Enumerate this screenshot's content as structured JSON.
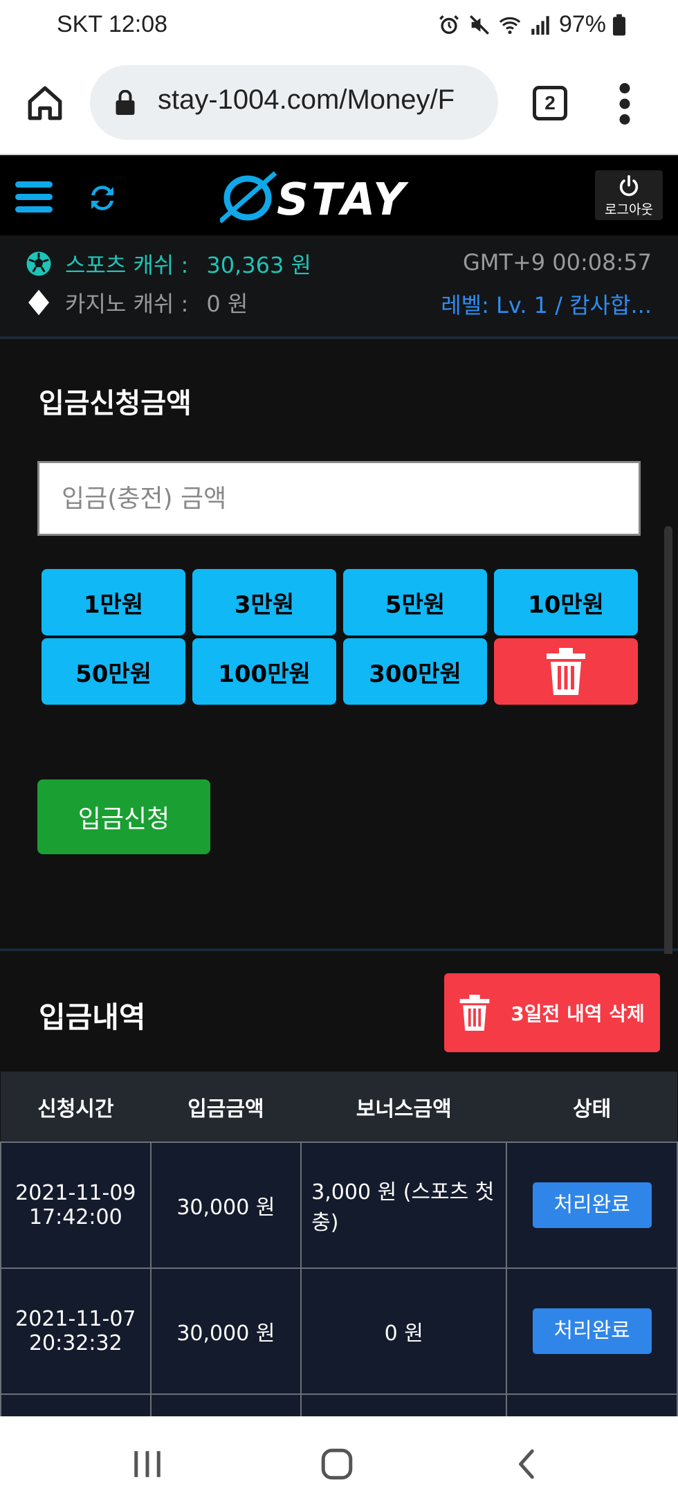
{
  "status_bar": {
    "carrier_time": "SKT  12:08",
    "battery": "97%"
  },
  "browser": {
    "url": "stay-1004.com/Money/F",
    "tab_count": "2"
  },
  "header": {
    "logo_text": "STAY",
    "logout_label": "로그아웃"
  },
  "cash": {
    "sports_label": "스포츠 캐쉬 :",
    "sports_value": "30,363 원",
    "casino_label": "카지노 캐쉬 :",
    "casino_value": "0 원",
    "gmt": "GMT+9 00:08:57",
    "level": "레벨: Lv. 1 / 캄사합..."
  },
  "deposit": {
    "title": "입금신청금액",
    "input_placeholder": "입금(충전) 금액",
    "amount_buttons": [
      "1만원",
      "3만원",
      "5만원",
      "10만원",
      "50만원",
      "100만원",
      "300만원"
    ],
    "submit_label": "입금신청"
  },
  "history": {
    "title": "입금내역",
    "delete_old_label": "3일전 내역 삭제",
    "columns": [
      "신청시간",
      "입금금액",
      "보너스금액",
      "상태"
    ],
    "rows": [
      {
        "date": "2021-11-09",
        "time": "17:42:00",
        "amount": "30,000 원",
        "bonus": "3,000 원 (스포츠 첫충)",
        "status": "처리완료"
      },
      {
        "date": "2021-11-07",
        "time": "20:32:32",
        "amount": "30,000 원",
        "bonus": "0 원",
        "status": "처리완료"
      }
    ]
  },
  "colors": {
    "accent_blue": "#10b8f5",
    "danger_red": "#f53b46",
    "submit_green": "#1aa032",
    "cash_teal": "#1ec4b8",
    "level_blue": "#2f8cf5"
  }
}
